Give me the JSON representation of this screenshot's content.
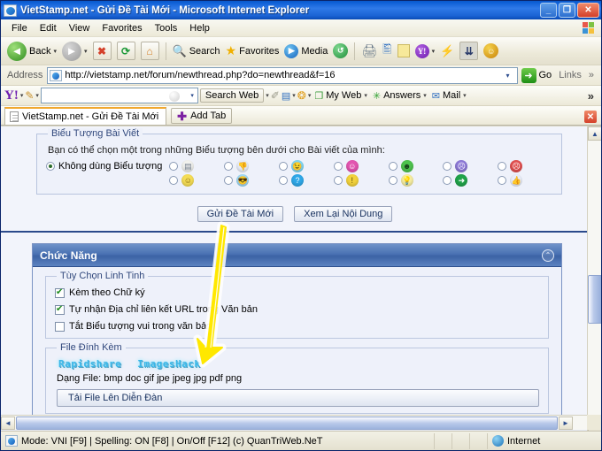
{
  "window": {
    "title": "VietStamp.net - Gửi Đề Tài Mới - Microsoft Internet Explorer",
    "app_icon": "ie-document-icon",
    "minimize_label": "_",
    "restore_label": "❐",
    "close_label": "✕"
  },
  "menu": {
    "items": [
      {
        "label": "File"
      },
      {
        "label": "Edit"
      },
      {
        "label": "View"
      },
      {
        "label": "Favorites"
      },
      {
        "label": "Tools"
      },
      {
        "label": "Help"
      }
    ]
  },
  "toolbar": {
    "back_label": "Back",
    "back_icon": "back-arrow-icon",
    "forward_icon": "forward-arrow-icon",
    "stop_icon": "stop-icon",
    "refresh_icon": "refresh-icon",
    "home_icon": "home-icon",
    "search_label": "Search",
    "search_icon": "magnifier-icon",
    "favorites_label": "Favorites",
    "favorites_icon": "star-icon",
    "media_label": "Media",
    "media_icon": "media-icon",
    "history_icon": "history-icon",
    "print_icon": "printer-icon",
    "edit_icon": "edit-page-icon",
    "notes_icon": "notepad-icon",
    "messenger_icon": "yahoo-messenger-icon",
    "mail_icon": "yahoo-mail-icon",
    "discuss_icon": "discuss-icon",
    "smiley_icon": "yahoo-smiley-icon",
    "dropdown_caret": "▾"
  },
  "address": {
    "label": "Address",
    "url": "http://vietstamp.net/forum/newthread.php?do=newthread&f=16",
    "page_icon": "page-icon",
    "dropdown_caret": "▾",
    "go_label": "Go",
    "go_icon": "go-arrow-icon",
    "links_label": "Links",
    "chevron": "»"
  },
  "yahoo_toolbar": {
    "logo": "Y!",
    "logo_caret": "▾",
    "pencil_icon": "pencil-icon",
    "search_value": "",
    "search_caret": "▾",
    "search_web_label": "Search Web",
    "search_web_caret": "▾",
    "highlight_icon": "highlighter-icon",
    "popup_icon": "popup-blocker-icon",
    "popup_caret": "▾",
    "antispy_icon": "anti-spy-icon",
    "antispy_caret": "▾",
    "myweb_label": "My Web",
    "myweb_icon": "my-web-icon",
    "myweb_caret": "▾",
    "answers_label": "Answers",
    "answers_icon": "answers-icon",
    "answers_caret": "▾",
    "mail_label": "Mail",
    "mail_icon": "mail-icon",
    "mail_caret": "▾",
    "overflow": "»"
  },
  "tabs": {
    "active_tab_label": "VietStamp.net - Gửi Đề Tài Mới",
    "tab_icon": "document-icon",
    "add_tab_label": "Add Tab",
    "add_tab_icon": "plus-icon",
    "close_tab_label": "✕"
  },
  "post_icons": {
    "legend": "Biểu Tượng Bài Viết",
    "description": "Bạn có thể chọn một trong những Biểu tượng bên dưới cho Bài viết của mình:",
    "no_icon_label": "Không dùng Biểu tượng",
    "no_icon_selected": true,
    "options": [
      {
        "name": "list-icon",
        "glyph": "▤",
        "bg": "#f2f2ee",
        "fg": "#6e7a8a"
      },
      {
        "name": "thumbs-down-icon",
        "glyph": "👎",
        "bg": "#e9eefa",
        "fg": "#d9534f"
      },
      {
        "name": "wink-face-icon",
        "glyph": "😉",
        "bg": "#7fd6f2",
        "fg": "#11405e"
      },
      {
        "name": "pink-smile-icon",
        "glyph": "☺",
        "bg": "#e255b0",
        "fg": "#fff"
      },
      {
        "name": "green-grin-icon",
        "glyph": "☻",
        "bg": "#4ec24e",
        "fg": "#16401b"
      },
      {
        "name": "purple-sad-icon",
        "glyph": "☹",
        "bg": "#8d7ad6",
        "fg": "#fff"
      },
      {
        "name": "red-angry-icon",
        "glyph": "☹",
        "bg": "#e05050",
        "fg": "#fff"
      },
      {
        "name": "yellow-smile-icon",
        "glyph": "☺",
        "bg": "#f5dd55",
        "fg": "#7a5f10"
      },
      {
        "name": "cool-face-icon",
        "glyph": "😎",
        "bg": "#9fd8f5",
        "fg": "#163a56"
      },
      {
        "name": "question-icon",
        "glyph": "?",
        "bg": "#2fa8e8",
        "fg": "#fff"
      },
      {
        "name": "warning-icon",
        "glyph": "!",
        "bg": "#f2d23c",
        "fg": "#5a4708"
      },
      {
        "name": "lightbulb-icon",
        "glyph": "💡",
        "bg": "#f6eda0",
        "fg": "#8a7a18"
      },
      {
        "name": "green-arrow-icon",
        "glyph": "➜",
        "bg": "#21a34a",
        "fg": "#fff"
      },
      {
        "name": "thumbs-up-icon",
        "glyph": "👍",
        "bg": "#e9eefa",
        "fg": "#d6a020"
      }
    ]
  },
  "actions": {
    "submit_label": "Gửi Đề Tài Mới",
    "preview_label": "Xem Lại Nội Dung"
  },
  "functions_panel": {
    "title": "Chức Năng",
    "collapse_icon": "collapse-icon",
    "collapse_glyph": "⌃",
    "misc_options": {
      "legend": "Tùy Chọn Linh Tinh",
      "checkboxes": [
        {
          "label": "Kèm theo Chữ ký",
          "checked": true
        },
        {
          "label": "Tự nhận Địa chỉ liên kết URL trong Văn bản",
          "checked": true
        },
        {
          "label": "Tắt Biểu tượng vui trong văn bản",
          "checked": false
        }
      ]
    },
    "attachments": {
      "legend": "File Đính Kèm",
      "hosts": [
        {
          "label": "Rapidshare"
        },
        {
          "label": "ImagesHack"
        }
      ],
      "filetypes_label": "Dạng File: bmp doc gif jpe jpeg jpg pdf png",
      "upload_label": "Tải File Lên Diễn Đàn"
    }
  },
  "annotation": {
    "arrow_color": "#ffe800",
    "arrow_glow": "#ffffff",
    "name": "yellow-pointer-arrow"
  },
  "scrollbars": {
    "up_glyph": "▲",
    "down_glyph": "▼",
    "left_glyph": "◄",
    "right_glyph": "►"
  },
  "statusbar": {
    "message": "Mode: VNI [F9] | Spelling: ON [F8] | On/Off [F12] (c) QuanTriWeb.NeT",
    "zone_label": "Internet",
    "zone_icon": "internet-zone-icon",
    "page_icon": "page-icon"
  }
}
